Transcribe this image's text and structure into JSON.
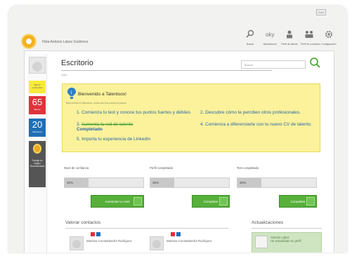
{
  "header": {
    "logout_label": "Salir",
    "user_greeting": "Hola Antonio López Gutiérrez",
    "nav": [
      {
        "label": "Buscar",
        "icon": "search-icon"
      },
      {
        "label": "Valoraciones",
        "icon": "thumbs-up-icon"
      },
      {
        "label": "Perfil de talento",
        "icon": "profile-icon"
      },
      {
        "label": "Perfil de contactos",
        "icon": "network-icon"
      },
      {
        "label": "Configuración",
        "icon": "gear-icon"
      }
    ]
  },
  "sidebar": {
    "badge_yellow": "Talento confirmado",
    "badge_red": {
      "value": "65",
      "label": "Talento"
    },
    "badge_blue": {
      "value": "20",
      "label": "Valoración"
    },
    "badge_gray": "Trabajo en equipo Recomendado"
  },
  "page": {
    "title": "Escritorio",
    "breadcrumb": "Inicio",
    "search_placeholder": "Buscar"
  },
  "welcome": {
    "title": "Bienvenido a Talentoos!",
    "subtitle": "Bienvenido a Talentoos, estos son tus primeros pasos",
    "steps": [
      {
        "num": "1.",
        "text": "Comienza tu test y conoce tus puntos fuertes y débiles"
      },
      {
        "num": "2.",
        "text": "Descubre cómo te perciben otros profesionales."
      },
      {
        "num": "3.",
        "text": "Aumenta tu red de talento",
        "status": "Completado"
      },
      {
        "num": "4.",
        "text": "Comienza a diferenciarte con tu nuevo CV de talento."
      },
      {
        "num": "5.",
        "text": "Importa tu experiencia de LinkedIn"
      }
    ]
  },
  "stats": [
    {
      "label": "Nivel de confianza",
      "value": "30%",
      "fraction": 0.3,
      "button": "Aumentar tu nivel"
    },
    {
      "label": "Perfil completado",
      "value": "30%",
      "fraction": 0.3,
      "button": "Completar"
    },
    {
      "label": "Test completado",
      "value": "30%",
      "fraction": 0.3,
      "button": "Completar"
    }
  ],
  "contacts": {
    "title": "Valorar contactos",
    "items": [
      {
        "name": "Mariana Constadeedra Rodríguez"
      },
      {
        "name": "Mariana Constadeedra Rodríguez"
      }
    ]
  },
  "updates": {
    "title": "Actualizaciones",
    "item": {
      "name": "Antonio López",
      "text": "Ha actualizado su perfil"
    }
  },
  "colors": {
    "accent_yellow": "#fbf29b",
    "green_button": "#57b03a",
    "red_badge": "#e0333c",
    "blue_badge": "#1f6fb4",
    "link_blue": "#2a67a8"
  }
}
